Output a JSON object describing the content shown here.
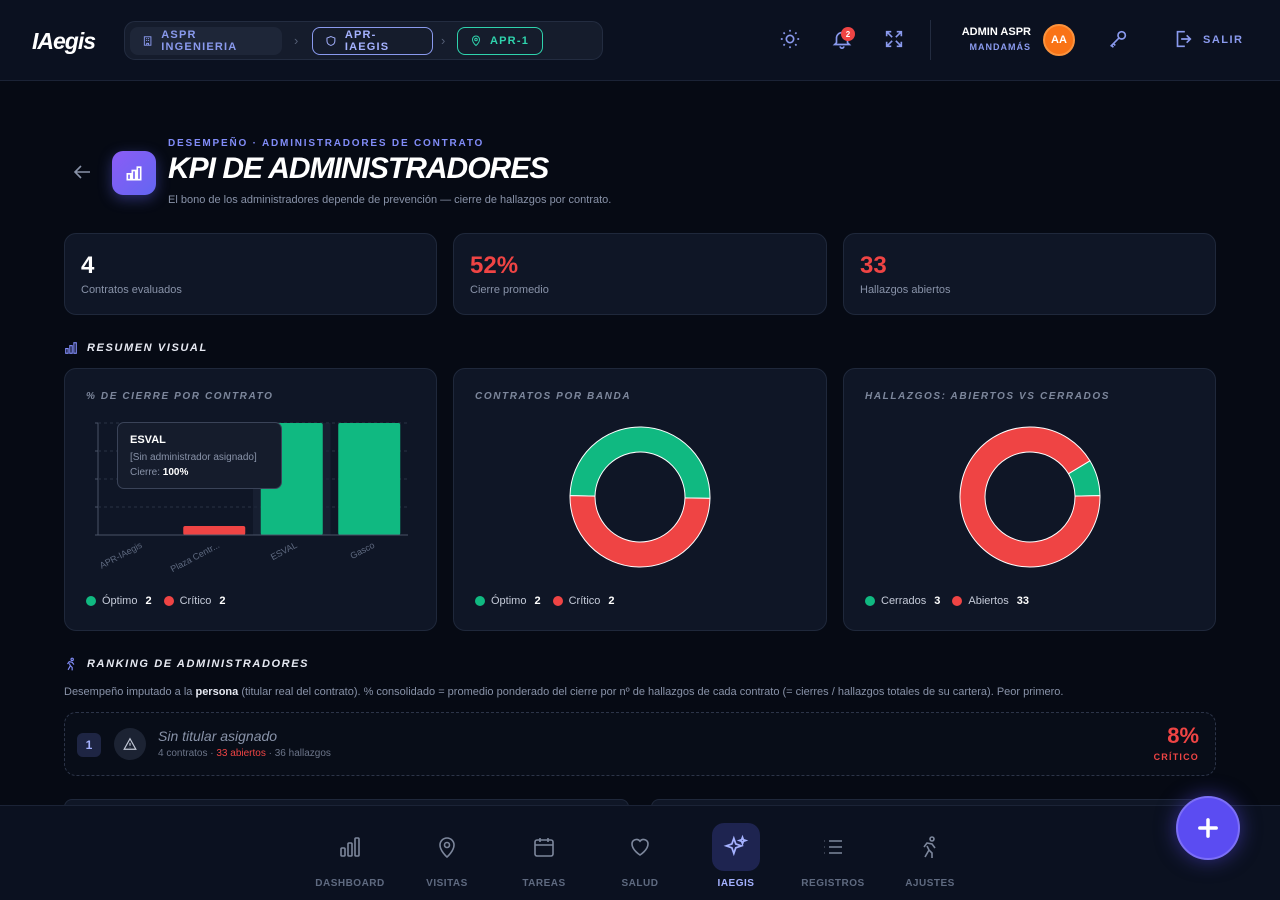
{
  "app": {
    "logo": "IAegis"
  },
  "breadcrumb": {
    "org": "ASPR INGENIERIA",
    "project": "APR-IAEGIS",
    "site": "APR-1"
  },
  "topbar": {
    "notif_count": "2",
    "user_name": "ADMIN ASPR",
    "user_role": "MANDAMÁS",
    "avatar": "AA",
    "logout": "SALIR"
  },
  "header": {
    "pretitle": "DESEMPEÑO · ADMINISTRADORES DE CONTRATO",
    "title": "KPI DE ADMINISTRADORES",
    "subtitle": "El bono de los administradores depende de prevención — cierre de hallazgos por contrato."
  },
  "kpis": [
    {
      "value": "4",
      "label": "Contratos evaluados",
      "color": "#ffffff"
    },
    {
      "value": "52%",
      "label": "Cierre promedio",
      "color": "#ef4444"
    },
    {
      "value": "33",
      "label": "Hallazgos abiertos",
      "color": "#ef4444"
    }
  ],
  "visual": {
    "section_title": "RESUMEN VISUAL"
  },
  "colors": {
    "optimo": "#10b981",
    "critico": "#ef4444"
  },
  "chart_data": [
    {
      "type": "bar",
      "title": "% DE CIERRE POR CONTRATO",
      "categories": [
        "APR-IAegis",
        "Plaza Centr...",
        "ESVAL",
        "Gasco"
      ],
      "values": [
        0,
        8,
        100,
        100
      ],
      "bar_colors": [
        "#ef4444",
        "#ef4444",
        "#10b981",
        "#10b981"
      ],
      "ylim": [
        0,
        100
      ],
      "tooltip": {
        "title": "ESVAL",
        "admin": "[Sin administrador asignado]",
        "label": "Cierre:",
        "value": "100%"
      },
      "legend": [
        {
          "name": "Óptimo",
          "count": "2",
          "color": "#10b981"
        },
        {
          "name": "Crítico",
          "count": "2",
          "color": "#ef4444"
        }
      ]
    },
    {
      "type": "pie",
      "title": "CONTRATOS POR BANDA",
      "labels": [
        "Óptimo",
        "Crítico"
      ],
      "values": [
        2,
        2
      ],
      "colors": [
        "#10b981",
        "#ef4444"
      ],
      "legend": [
        {
          "name": "Óptimo",
          "count": "2",
          "color": "#10b981"
        },
        {
          "name": "Crítico",
          "count": "2",
          "color": "#ef4444"
        }
      ]
    },
    {
      "type": "pie",
      "title": "HALLAZGOS: ABIERTOS VS CERRADOS",
      "labels": [
        "Cerrados",
        "Abiertos"
      ],
      "values": [
        3,
        33
      ],
      "colors": [
        "#10b981",
        "#ef4444"
      ],
      "legend": [
        {
          "name": "Cerrados",
          "count": "3",
          "color": "#10b981"
        },
        {
          "name": "Abiertos",
          "count": "33",
          "color": "#ef4444"
        }
      ]
    }
  ],
  "ranking": {
    "section_title": "RANKING DE ADMINISTRADORES",
    "desc_pre": "Desempeño imputado a la ",
    "desc_bold": "persona",
    "desc_post": " (titular real del contrato). % consolidado = promedio ponderado del cierre por nº de hallazgos de cada contrato (= cierres / hallazgos totales de su cartera). Peor primero.",
    "rows": [
      {
        "rank": "1",
        "name": "Sin titular asignado",
        "contracts": "4 contratos",
        "open": "33 abiertos",
        "findings": "36 hallazgos",
        "pct": "8%",
        "band": "CRÍTICO"
      }
    ]
  },
  "nav": [
    {
      "label": "DASHBOARD",
      "icon": "chart-icon"
    },
    {
      "label": "VISITAS",
      "icon": "map-pin-icon"
    },
    {
      "label": "TAREAS",
      "icon": "calendar-icon"
    },
    {
      "label": "SALUD",
      "icon": "heart-icon"
    },
    {
      "label": "IAEGIS",
      "icon": "sparkles-icon"
    },
    {
      "label": "REGISTROS",
      "icon": "list-icon"
    },
    {
      "label": "AJUSTES",
      "icon": "runner-icon"
    }
  ]
}
